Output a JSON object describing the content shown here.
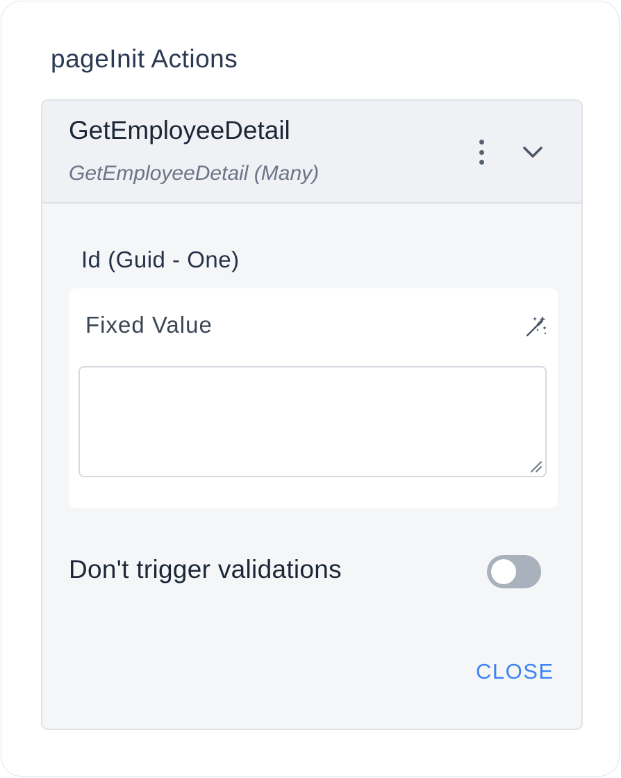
{
  "section": {
    "title": "pageInit Actions"
  },
  "action": {
    "name": "GetEmployeeDetail",
    "subtitle": "GetEmployeeDetail (Many)",
    "more_icon": "kebab-vertical-icon",
    "expand_icon": "chevron-down-icon"
  },
  "parameter": {
    "label": "Id (Guid - One)",
    "value_type": "Fixed Value",
    "value": "",
    "magic_icon": "magic-wand-icon"
  },
  "validation": {
    "label": "Don't trigger validations",
    "enabled": false
  },
  "footer": {
    "close_label": "CLOSE"
  },
  "colors": {
    "accent": "#3b82f6",
    "card_bg": "#f5f6f8",
    "header_bg": "#eff1f4",
    "toggle_off": "#a9b1bc"
  }
}
